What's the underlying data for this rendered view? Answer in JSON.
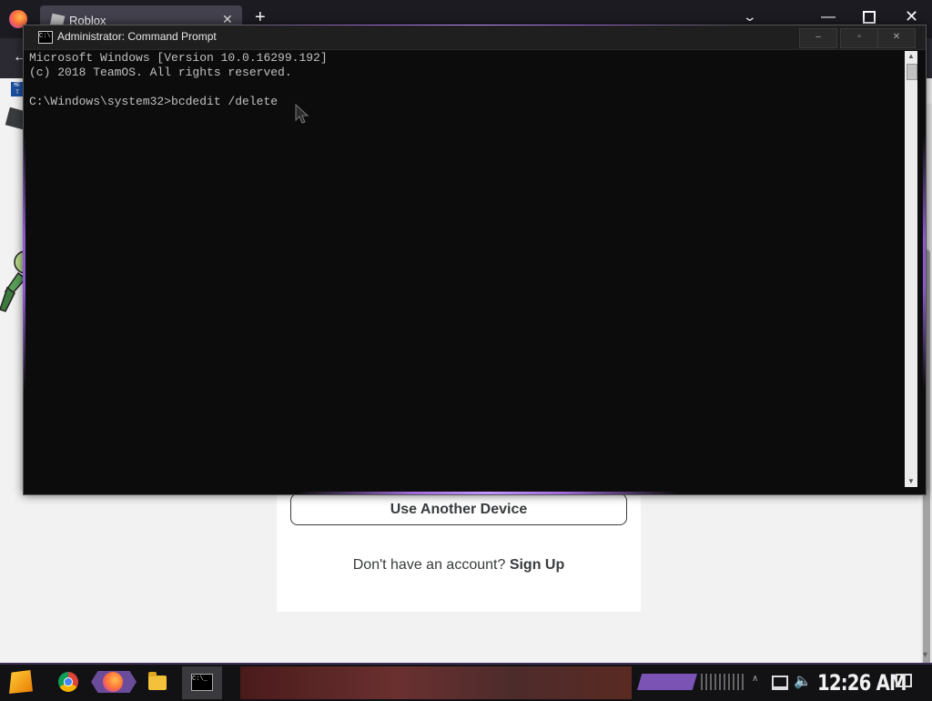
{
  "browser": {
    "tab_title": "Roblox",
    "tab_close": "✕",
    "new_tab": "+",
    "bookmark_label": "MF T"
  },
  "page": {
    "device_button": "Use Another Device",
    "signup_prompt": "Don't have an account?",
    "signup_link": "Sign Up"
  },
  "cmd": {
    "title": "Administrator: Command Prompt",
    "icon_text": "C:\\",
    "lines": [
      "Microsoft Windows [Version 10.0.16299.192]",
      "(c) 2018 TeamOS. All rights reserved.",
      "",
      "C:\\Windows\\system32>bcdedit /delete"
    ],
    "controls": {
      "minimize": "–",
      "maximize": "▫",
      "close": "✕"
    }
  },
  "taskbar": {
    "clock": "12:26 AM",
    "cmd_icon_text": "C:\\_",
    "apps": [
      "start-icon",
      "chrome-icon",
      "firefox-icon",
      "file-explorer-icon",
      "command-prompt-icon"
    ]
  },
  "colors": {
    "console_bg": "#0c0c0c",
    "console_text": "#c0c0c0",
    "accent_purple": "#8c5ad0",
    "page_bg": "#f2f2f2"
  }
}
